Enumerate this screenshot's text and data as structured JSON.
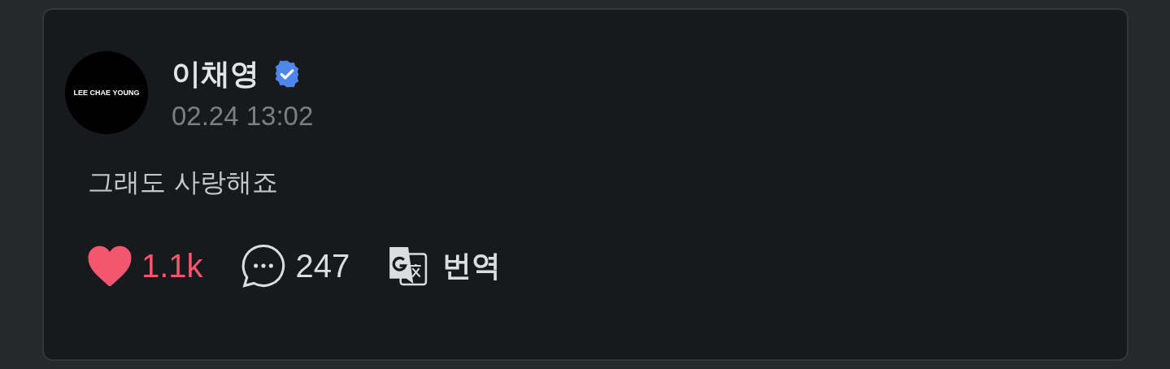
{
  "post": {
    "avatar_text": "LEE CHAE YOUNG",
    "author": "이채영",
    "verified": true,
    "time": "02.24 13:02",
    "text": "그래도 사랑해죠",
    "likes": {
      "count": "1.1k",
      "liked": true
    },
    "comments": {
      "count": "247"
    },
    "translate": {
      "label": "번역"
    }
  }
}
